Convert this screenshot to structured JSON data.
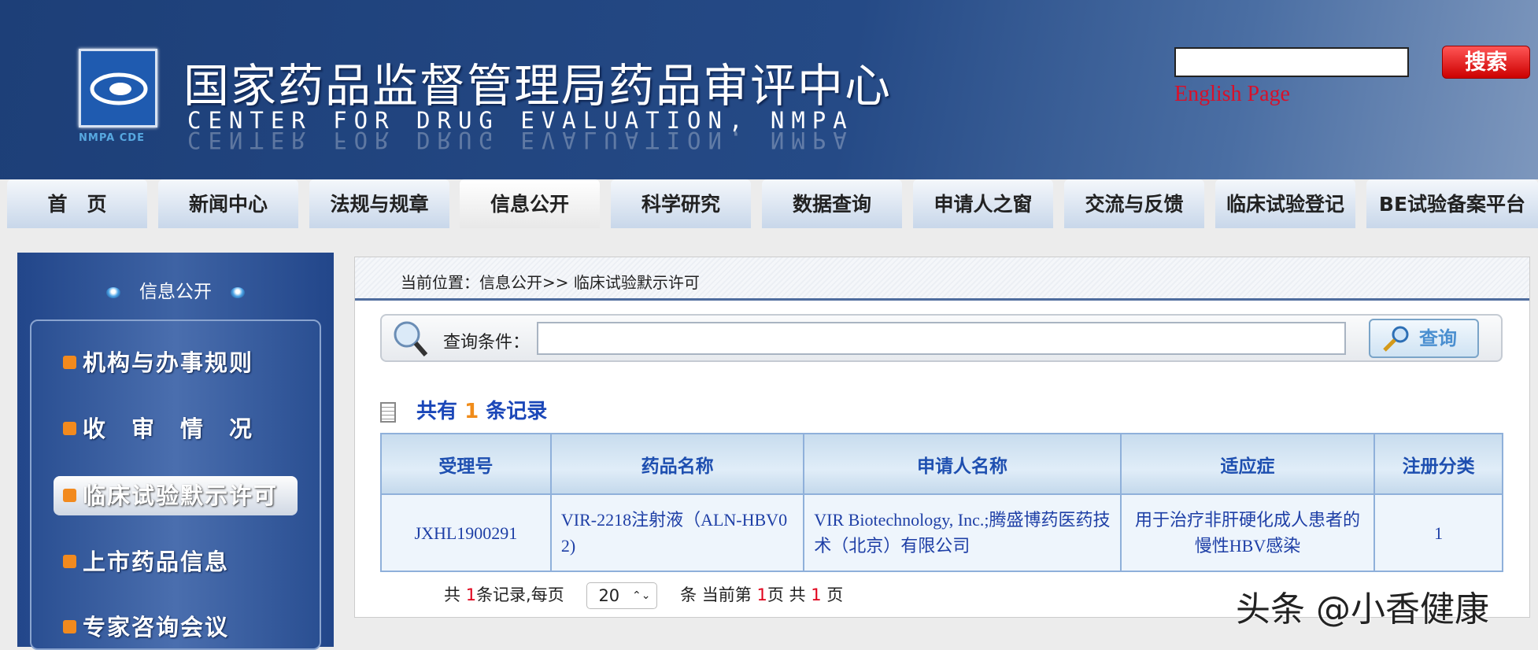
{
  "header": {
    "title_cn": "国家药品监督管理局药品审评中心",
    "title_en": "CENTER FOR DRUG EVALUATION, NMPA",
    "logo_caption": "NMPA CDE",
    "search_button": "搜索",
    "search_value": "",
    "english_link": "English Page"
  },
  "nav": [
    "首　页",
    "新闻中心",
    "法规与规章",
    "信息公开",
    "科学研究",
    "数据查询",
    "申请人之窗",
    "交流与反馈",
    "临床试验登记",
    "BE试验备案平台"
  ],
  "sidebar": {
    "title": "信息公开",
    "items": [
      "机构与办事规则",
      "收　审　情　况",
      "临床试验默示许可",
      "上市药品信息",
      "专家咨询会议"
    ]
  },
  "breadcrumb": "当前位置：信息公开>> 临床试验默示许可",
  "query": {
    "label": "查询条件：",
    "value": "",
    "button": "查询"
  },
  "records": {
    "prefix": "共有",
    "count": "1",
    "suffix": "条记录"
  },
  "table": {
    "headers": [
      "受理号",
      "药品名称",
      "申请人名称",
      "适应症",
      "注册分类"
    ],
    "rows": [
      [
        "JXHL1900291",
        "VIR-2218注射液（ALN-HBV02)",
        "VIR Biotechnology, Inc.;腾盛博药医药技术（北京）有限公司",
        "用于治疗非肝硬化成人患者的慢性HBV感染",
        "1"
      ]
    ]
  },
  "pager": {
    "t1": "共 ",
    "total": "1",
    "t2": "条记录,每页",
    "page_size": "20",
    "t3": "条 当前第 ",
    "current": "1",
    "t4": "页 共 ",
    "pages": "1",
    "t5": " 页"
  },
  "watermark": "头条 @小香健康"
}
